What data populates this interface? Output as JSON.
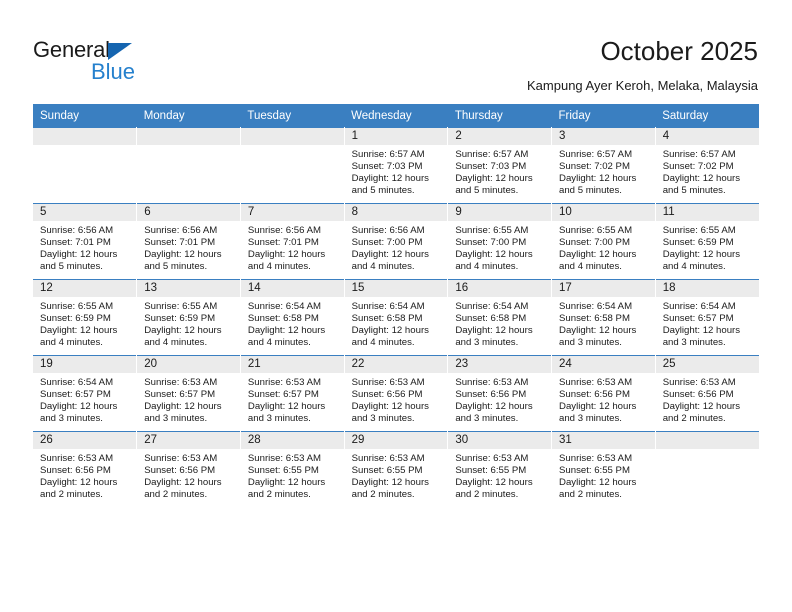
{
  "brand": {
    "name_part1": "General",
    "name_part2": "Blue",
    "triangle_color": "#1565b0",
    "blue_color": "#2580cd"
  },
  "header": {
    "title": "October 2025",
    "subtitle": "Kampung Ayer Keroh, Melaka, Malaysia"
  },
  "theme": {
    "header_row_bg": "#3a7fc1",
    "daynum_band_bg": "#ebebeb",
    "text_color": "#1b1b1b"
  },
  "calendar": {
    "weekday_headers": [
      "Sunday",
      "Monday",
      "Tuesday",
      "Wednesday",
      "Thursday",
      "Friday",
      "Saturday"
    ],
    "labels": {
      "sunrise": "Sunrise:",
      "sunset": "Sunset:",
      "daylight": "Daylight:"
    },
    "weeks": [
      [
        {
          "day": "",
          "empty": true
        },
        {
          "day": "",
          "empty": true
        },
        {
          "day": "",
          "empty": true
        },
        {
          "day": "1",
          "sunrise": "Sunrise: 6:57 AM",
          "sunset": "Sunset: 7:03 PM",
          "daylight1": "Daylight: 12 hours",
          "daylight2": "and 5 minutes."
        },
        {
          "day": "2",
          "sunrise": "Sunrise: 6:57 AM",
          "sunset": "Sunset: 7:03 PM",
          "daylight1": "Daylight: 12 hours",
          "daylight2": "and 5 minutes."
        },
        {
          "day": "3",
          "sunrise": "Sunrise: 6:57 AM",
          "sunset": "Sunset: 7:02 PM",
          "daylight1": "Daylight: 12 hours",
          "daylight2": "and 5 minutes."
        },
        {
          "day": "4",
          "sunrise": "Sunrise: 6:57 AM",
          "sunset": "Sunset: 7:02 PM",
          "daylight1": "Daylight: 12 hours",
          "daylight2": "and 5 minutes."
        }
      ],
      [
        {
          "day": "5",
          "sunrise": "Sunrise: 6:56 AM",
          "sunset": "Sunset: 7:01 PM",
          "daylight1": "Daylight: 12 hours",
          "daylight2": "and 5 minutes."
        },
        {
          "day": "6",
          "sunrise": "Sunrise: 6:56 AM",
          "sunset": "Sunset: 7:01 PM",
          "daylight1": "Daylight: 12 hours",
          "daylight2": "and 5 minutes."
        },
        {
          "day": "7",
          "sunrise": "Sunrise: 6:56 AM",
          "sunset": "Sunset: 7:01 PM",
          "daylight1": "Daylight: 12 hours",
          "daylight2": "and 4 minutes."
        },
        {
          "day": "8",
          "sunrise": "Sunrise: 6:56 AM",
          "sunset": "Sunset: 7:00 PM",
          "daylight1": "Daylight: 12 hours",
          "daylight2": "and 4 minutes."
        },
        {
          "day": "9",
          "sunrise": "Sunrise: 6:55 AM",
          "sunset": "Sunset: 7:00 PM",
          "daylight1": "Daylight: 12 hours",
          "daylight2": "and 4 minutes."
        },
        {
          "day": "10",
          "sunrise": "Sunrise: 6:55 AM",
          "sunset": "Sunset: 7:00 PM",
          "daylight1": "Daylight: 12 hours",
          "daylight2": "and 4 minutes."
        },
        {
          "day": "11",
          "sunrise": "Sunrise: 6:55 AM",
          "sunset": "Sunset: 6:59 PM",
          "daylight1": "Daylight: 12 hours",
          "daylight2": "and 4 minutes."
        }
      ],
      [
        {
          "day": "12",
          "sunrise": "Sunrise: 6:55 AM",
          "sunset": "Sunset: 6:59 PM",
          "daylight1": "Daylight: 12 hours",
          "daylight2": "and 4 minutes."
        },
        {
          "day": "13",
          "sunrise": "Sunrise: 6:55 AM",
          "sunset": "Sunset: 6:59 PM",
          "daylight1": "Daylight: 12 hours",
          "daylight2": "and 4 minutes."
        },
        {
          "day": "14",
          "sunrise": "Sunrise: 6:54 AM",
          "sunset": "Sunset: 6:58 PM",
          "daylight1": "Daylight: 12 hours",
          "daylight2": "and 4 minutes."
        },
        {
          "day": "15",
          "sunrise": "Sunrise: 6:54 AM",
          "sunset": "Sunset: 6:58 PM",
          "daylight1": "Daylight: 12 hours",
          "daylight2": "and 4 minutes."
        },
        {
          "day": "16",
          "sunrise": "Sunrise: 6:54 AM",
          "sunset": "Sunset: 6:58 PM",
          "daylight1": "Daylight: 12 hours",
          "daylight2": "and 3 minutes."
        },
        {
          "day": "17",
          "sunrise": "Sunrise: 6:54 AM",
          "sunset": "Sunset: 6:58 PM",
          "daylight1": "Daylight: 12 hours",
          "daylight2": "and 3 minutes."
        },
        {
          "day": "18",
          "sunrise": "Sunrise: 6:54 AM",
          "sunset": "Sunset: 6:57 PM",
          "daylight1": "Daylight: 12 hours",
          "daylight2": "and 3 minutes."
        }
      ],
      [
        {
          "day": "19",
          "sunrise": "Sunrise: 6:54 AM",
          "sunset": "Sunset: 6:57 PM",
          "daylight1": "Daylight: 12 hours",
          "daylight2": "and 3 minutes."
        },
        {
          "day": "20",
          "sunrise": "Sunrise: 6:53 AM",
          "sunset": "Sunset: 6:57 PM",
          "daylight1": "Daylight: 12 hours",
          "daylight2": "and 3 minutes."
        },
        {
          "day": "21",
          "sunrise": "Sunrise: 6:53 AM",
          "sunset": "Sunset: 6:57 PM",
          "daylight1": "Daylight: 12 hours",
          "daylight2": "and 3 minutes."
        },
        {
          "day": "22",
          "sunrise": "Sunrise: 6:53 AM",
          "sunset": "Sunset: 6:56 PM",
          "daylight1": "Daylight: 12 hours",
          "daylight2": "and 3 minutes."
        },
        {
          "day": "23",
          "sunrise": "Sunrise: 6:53 AM",
          "sunset": "Sunset: 6:56 PM",
          "daylight1": "Daylight: 12 hours",
          "daylight2": "and 3 minutes."
        },
        {
          "day": "24",
          "sunrise": "Sunrise: 6:53 AM",
          "sunset": "Sunset: 6:56 PM",
          "daylight1": "Daylight: 12 hours",
          "daylight2": "and 3 minutes."
        },
        {
          "day": "25",
          "sunrise": "Sunrise: 6:53 AM",
          "sunset": "Sunset: 6:56 PM",
          "daylight1": "Daylight: 12 hours",
          "daylight2": "and 2 minutes."
        }
      ],
      [
        {
          "day": "26",
          "sunrise": "Sunrise: 6:53 AM",
          "sunset": "Sunset: 6:56 PM",
          "daylight1": "Daylight: 12 hours",
          "daylight2": "and 2 minutes."
        },
        {
          "day": "27",
          "sunrise": "Sunrise: 6:53 AM",
          "sunset": "Sunset: 6:56 PM",
          "daylight1": "Daylight: 12 hours",
          "daylight2": "and 2 minutes."
        },
        {
          "day": "28",
          "sunrise": "Sunrise: 6:53 AM",
          "sunset": "Sunset: 6:55 PM",
          "daylight1": "Daylight: 12 hours",
          "daylight2": "and 2 minutes."
        },
        {
          "day": "29",
          "sunrise": "Sunrise: 6:53 AM",
          "sunset": "Sunset: 6:55 PM",
          "daylight1": "Daylight: 12 hours",
          "daylight2": "and 2 minutes."
        },
        {
          "day": "30",
          "sunrise": "Sunrise: 6:53 AM",
          "sunset": "Sunset: 6:55 PM",
          "daylight1": "Daylight: 12 hours",
          "daylight2": "and 2 minutes."
        },
        {
          "day": "31",
          "sunrise": "Sunrise: 6:53 AM",
          "sunset": "Sunset: 6:55 PM",
          "daylight1": "Daylight: 12 hours",
          "daylight2": "and 2 minutes."
        },
        {
          "day": "",
          "empty": true
        }
      ]
    ]
  }
}
